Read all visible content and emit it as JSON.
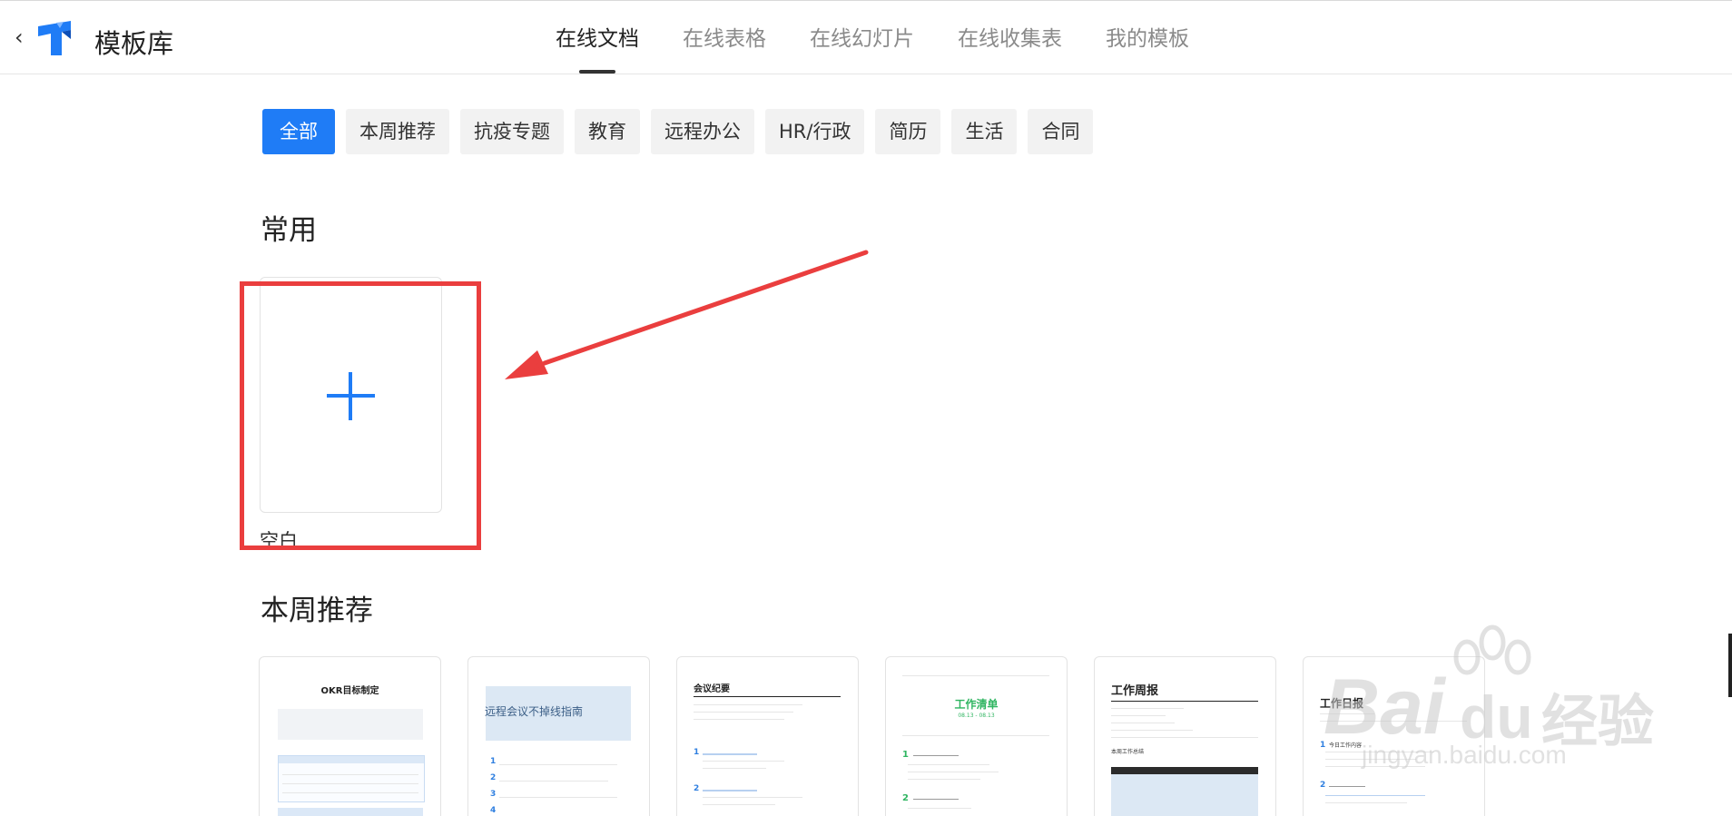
{
  "header": {
    "back_icon": "chevron-left-icon",
    "logo_icon": "tencent-docs-logo-icon",
    "title": "模板库",
    "tabs": [
      {
        "label": "在线文档",
        "active": true
      },
      {
        "label": "在线表格",
        "active": false
      },
      {
        "label": "在线幻灯片",
        "active": false
      },
      {
        "label": "在线收集表",
        "active": false
      },
      {
        "label": "我的模板",
        "active": false
      }
    ]
  },
  "filters": {
    "chips": [
      {
        "label": "全部",
        "active": true
      },
      {
        "label": "本周推荐",
        "active": false
      },
      {
        "label": "抗疫专题",
        "active": false
      },
      {
        "label": "教育",
        "active": false
      },
      {
        "label": "远程办公",
        "active": false
      },
      {
        "label": "HR/行政",
        "active": false
      },
      {
        "label": "简历",
        "active": false
      },
      {
        "label": "生活",
        "active": false
      },
      {
        "label": "合同",
        "active": false
      }
    ]
  },
  "sections": {
    "common_title": "常用",
    "blank_label": "空白",
    "weekly_title": "本周推荐"
  },
  "templates": [
    {
      "title": "OKR目标制定"
    },
    {
      "title": "远程会议不掉线指南"
    },
    {
      "title": "会议纪要"
    },
    {
      "title": "工作清单",
      "subtitle": "08.13 - 08.13"
    },
    {
      "title": "工作周报",
      "section": "本周工作总结"
    },
    {
      "title": "工作日报",
      "section": "今日工作内容"
    }
  ],
  "watermark": {
    "brand": "Bai",
    "brand2": "du",
    "cn": "经验",
    "url": "jingyan.baidu.com"
  },
  "colors": {
    "accent": "#1f7cf6",
    "highlight_box": "#ea3e3e",
    "active_tab_indicator": "#333333"
  }
}
